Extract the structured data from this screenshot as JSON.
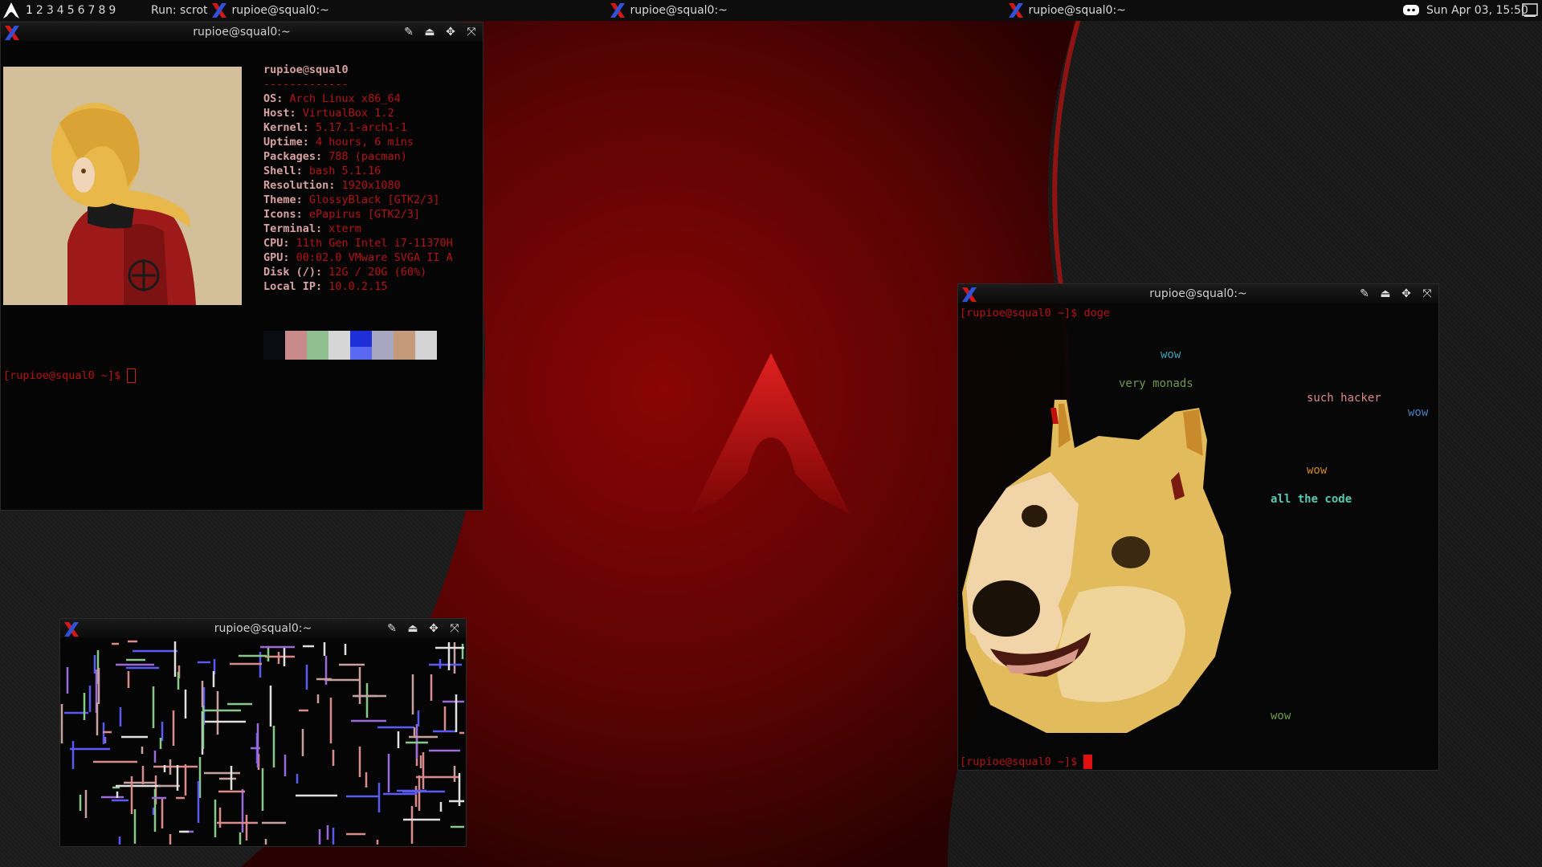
{
  "panel": {
    "workspaces": [
      "1",
      "2",
      "3",
      "4",
      "5",
      "6",
      "7",
      "8",
      "9"
    ],
    "active_workspace": "1",
    "run_label": "Run: scrot",
    "tasks": [
      "rupioe@squal0:~",
      "rupioe@squal0:~",
      "rupioe@squal0:~"
    ],
    "clock": "Sun Apr 03, 15:50"
  },
  "windows": {
    "neofetch": {
      "title": "rupioe@squal0:~",
      "header_user": "rupioe",
      "header_at": "@",
      "header_host": "squal0",
      "separator": "-------------",
      "info": [
        {
          "key": "OS",
          "value": "Arch Linux x86_64"
        },
        {
          "key": "Host",
          "value": "VirtualBox 1.2"
        },
        {
          "key": "Kernel",
          "value": "5.17.1-arch1-1"
        },
        {
          "key": "Uptime",
          "value": "4 hours, 6 mins"
        },
        {
          "key": "Packages",
          "value": "788 (pacman)"
        },
        {
          "key": "Shell",
          "value": "bash 5.1.16"
        },
        {
          "key": "Resolution",
          "value": "1920x1080"
        },
        {
          "key": "Theme",
          "value": "GlossyBlack [GTK2/3]"
        },
        {
          "key": "Icons",
          "value": "ePapirus [GTK2/3]"
        },
        {
          "key": "Terminal",
          "value": "xterm"
        },
        {
          "key": "CPU",
          "value": "11th Gen Intel i7-11370H"
        },
        {
          "key": "GPU",
          "value": "00:02.0 VMware SVGA II A"
        },
        {
          "key": "Disk (/)",
          "value": "12G / 20G (60%)"
        },
        {
          "key": "Local IP",
          "value": "10.0.2.15"
        }
      ],
      "palette": [
        "#0b0b14",
        "#c98a8a",
        "#8fbf8f",
        "#d6d6d6",
        "#1f2fd8",
        "#a7a7c2",
        "#c49a7a",
        "#d4d4d4"
      ],
      "palette_bottom": [
        "#0b0b14",
        "#c98a8a",
        "#8fbf8f",
        "#d6d6d6",
        "#5a6af0",
        "#a7a7c2",
        "#c49a7a",
        "#d4d4d4"
      ],
      "prompt": "[rupioe@squal0 ~]$ "
    },
    "pipes": {
      "title": "rupioe@squal0:~"
    },
    "doge": {
      "title": "rupioe@squal0:~",
      "command_prompt": "[rupioe@squal0 ~]$ ",
      "command": "doge",
      "phrases": [
        {
          "text": "wow",
          "color": "#3fa3b8"
        },
        {
          "text": "very monads",
          "color": "#6f9a4d"
        },
        {
          "text": "such hacker",
          "color": "#d98a8a"
        },
        {
          "text": "wow",
          "color": "#4d7fc4"
        },
        {
          "text": "wow",
          "color": "#d08a2a"
        },
        {
          "text": "all the code",
          "color": "#58c9b3"
        },
        {
          "text": "wow",
          "color": "#6f9a4d"
        }
      ],
      "prompt": "[rupioe@squal0 ~]$ "
    }
  }
}
